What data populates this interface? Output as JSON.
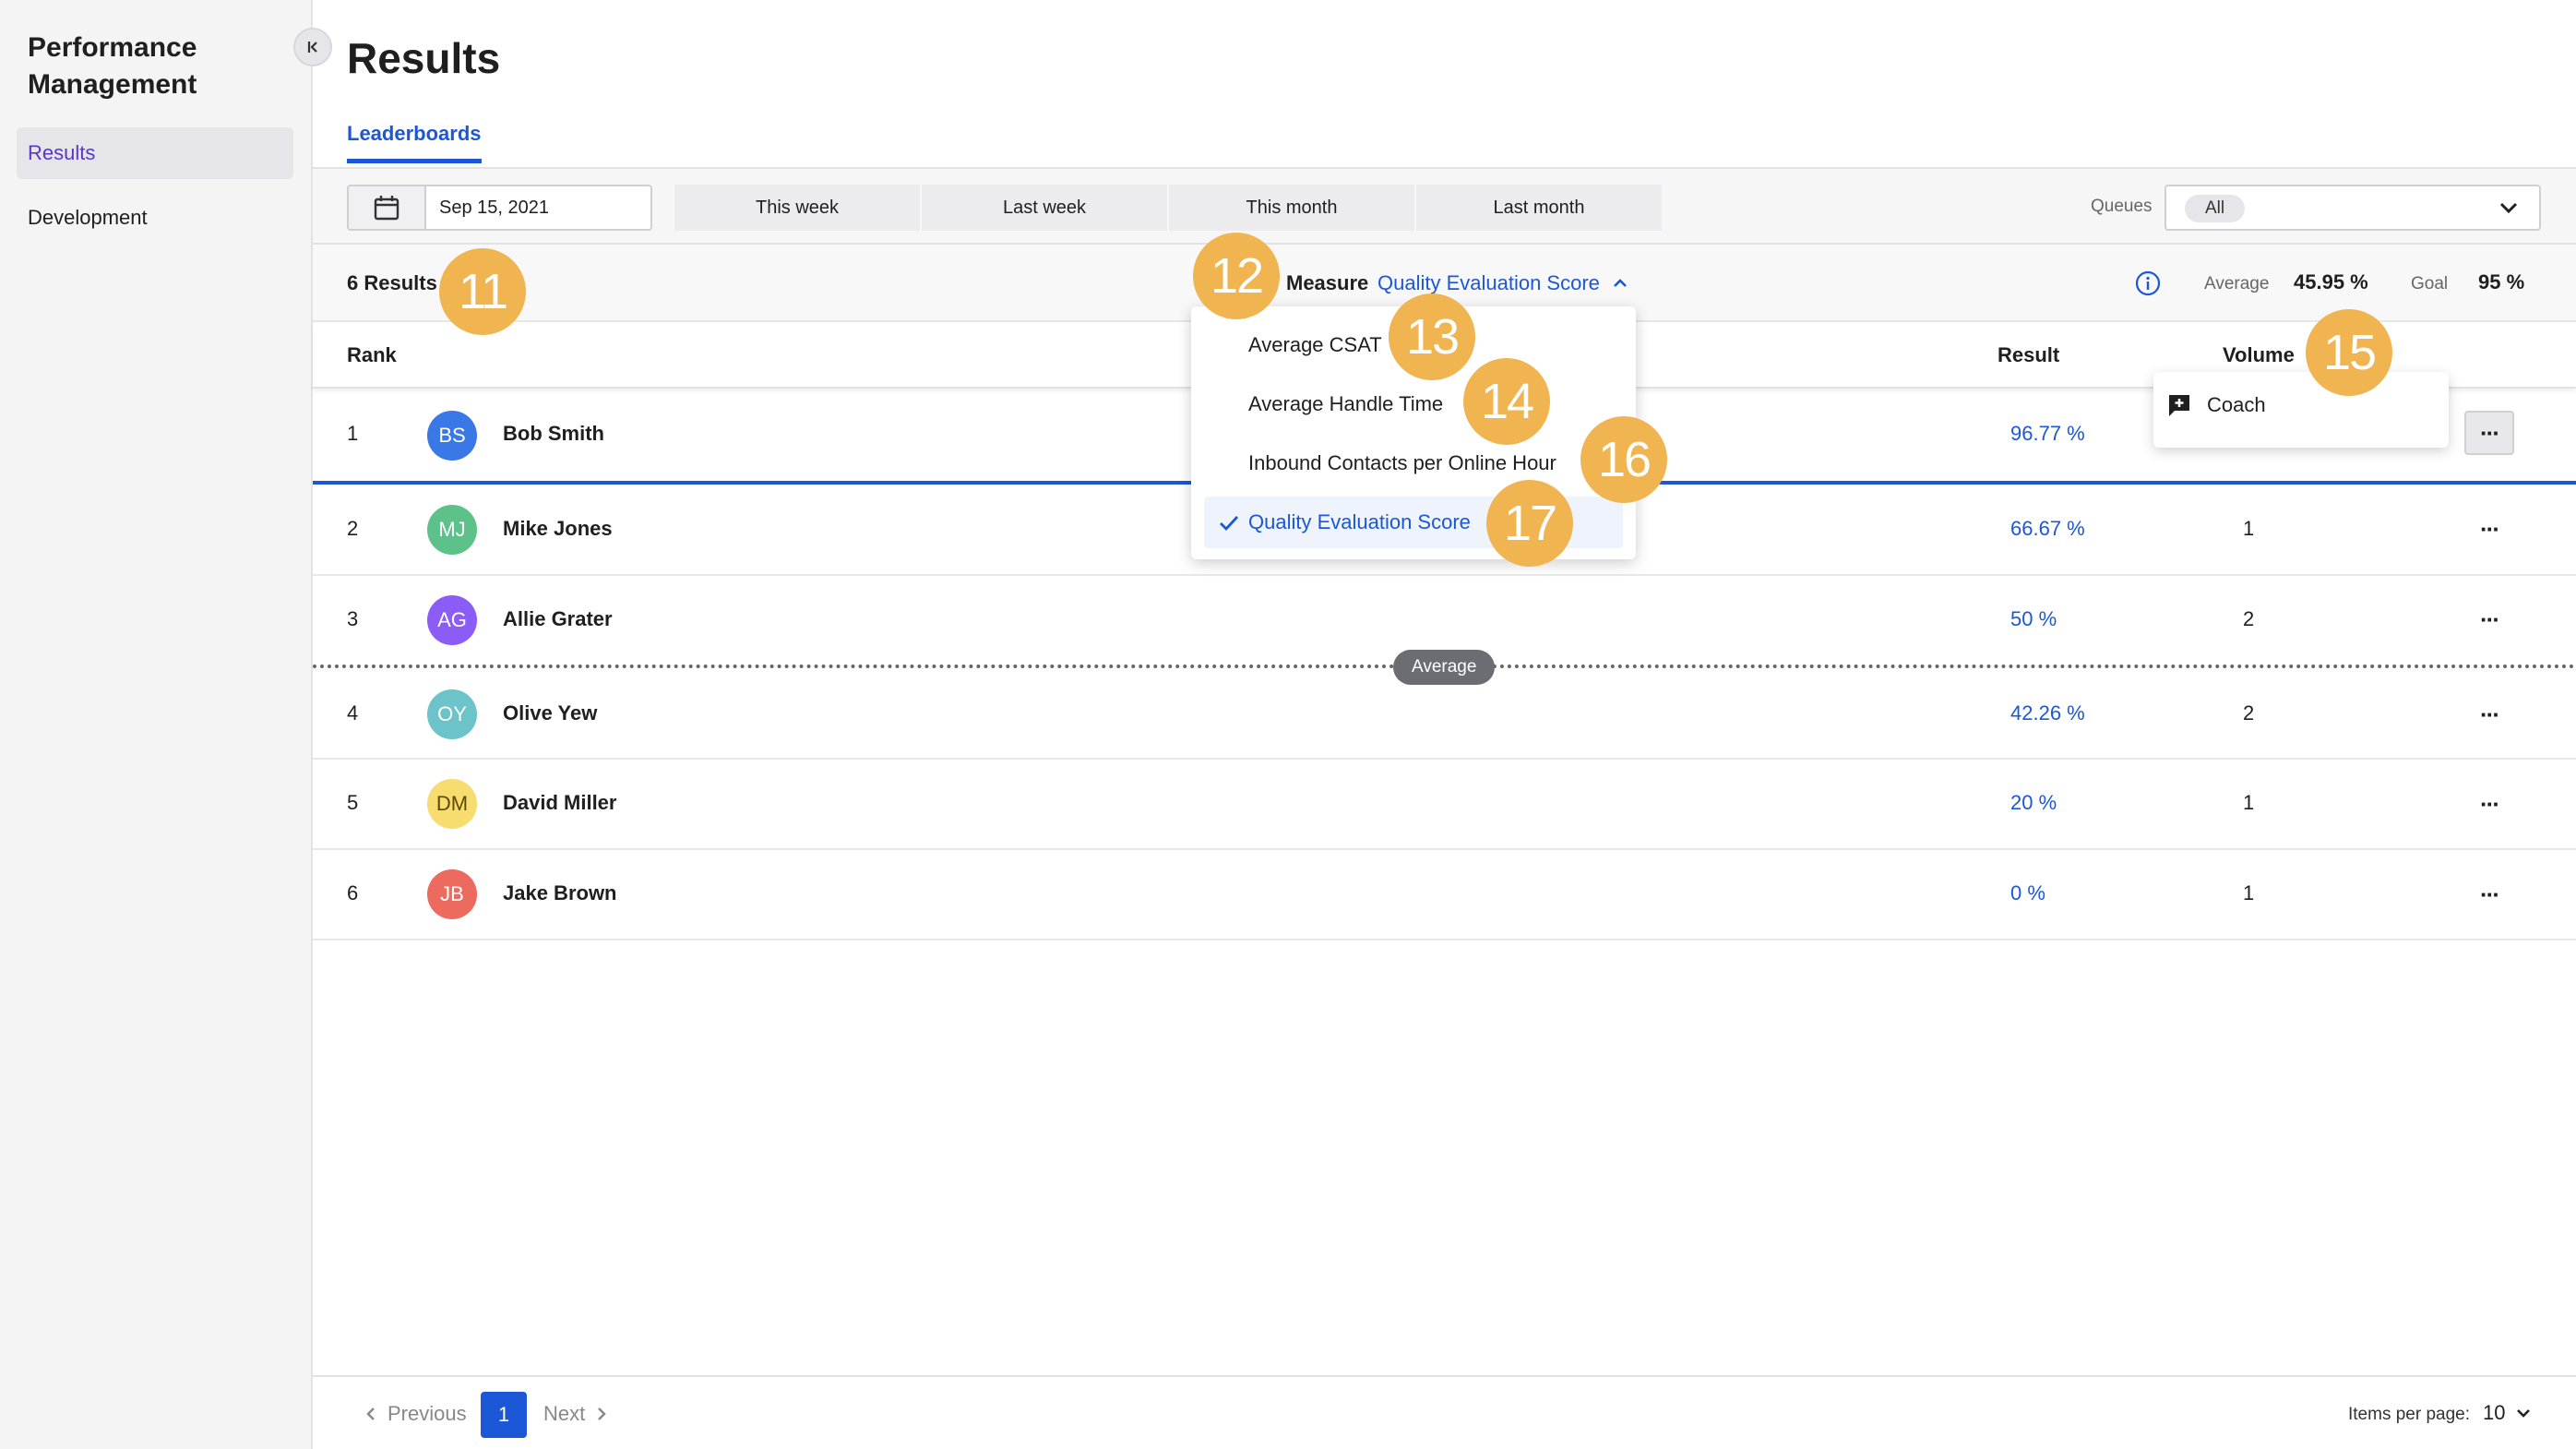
{
  "sidebar": {
    "app_title": "Performance Management",
    "items": [
      {
        "label": "Results",
        "active": true
      },
      {
        "label": "Development",
        "active": false
      }
    ]
  },
  "header": {
    "title": "Results",
    "tabs": [
      {
        "label": "Leaderboards",
        "active": true
      }
    ]
  },
  "toolbar": {
    "date": "Sep 15, 2021",
    "ranges": [
      "This week",
      "Last week",
      "This month",
      "Last month"
    ],
    "queues_label": "Queues",
    "queues_value": "All"
  },
  "summary": {
    "results_count": "6 Results",
    "measure_label": "Measure",
    "measure_value": "Quality Evaluation Score",
    "average_label": "Average",
    "average_value": "45.95 %",
    "goal_label": "Goal",
    "goal_value": "95 %"
  },
  "table": {
    "headers": {
      "rank": "Rank",
      "result": "Result",
      "volume": "Volume"
    },
    "rows": [
      {
        "rank": "1",
        "initials": "BS",
        "name": "Bob Smith",
        "result": "96.77 %",
        "volume": "",
        "avatar_color": "#3b78e7",
        "avatar_text": "#ffffff"
      },
      {
        "rank": "2",
        "initials": "MJ",
        "name": "Mike Jones",
        "result": "66.67 %",
        "volume": "1",
        "avatar_color": "#5cc28a",
        "avatar_text": "#ffffff"
      },
      {
        "rank": "3",
        "initials": "AG",
        "name": "Allie Grater",
        "result": "50 %",
        "volume": "2",
        "avatar_color": "#8b5cf6",
        "avatar_text": "#ffffff"
      },
      {
        "rank": "4",
        "initials": "OY",
        "name": "Olive Yew",
        "result": "42.26 %",
        "volume": "2",
        "avatar_color": "#6cc3c9",
        "avatar_text": "#ffffff"
      },
      {
        "rank": "5",
        "initials": "DM",
        "name": "David Miller",
        "result": "20 %",
        "volume": "1",
        "avatar_color": "#f7dc6f",
        "avatar_text": "#5a4a00"
      },
      {
        "rank": "6",
        "initials": "JB",
        "name": "Jake Brown",
        "result": "0 %",
        "volume": "1",
        "avatar_color": "#ec6a5e",
        "avatar_text": "#ffffff"
      }
    ],
    "average_marker": "Average"
  },
  "measure_menu": {
    "items": [
      {
        "label": "Average CSAT",
        "selected": false
      },
      {
        "label": "Average Handle Time",
        "selected": false
      },
      {
        "label": "Inbound Contacts per Online Hour",
        "selected": false
      },
      {
        "label": "Quality Evaluation Score",
        "selected": true
      }
    ]
  },
  "row_menu": {
    "items": [
      {
        "label": "Coach",
        "icon": "add-comment-icon"
      }
    ]
  },
  "badges": [
    "11",
    "12",
    "13",
    "14",
    "15",
    "16",
    "17"
  ],
  "pagination": {
    "previous": "Previous",
    "current": "1",
    "next": "Next",
    "items_per_page_label": "Items per page:",
    "items_per_page_value": "10"
  },
  "colors": {
    "accent": "#1b57d6",
    "badge": "#f0b450",
    "selected_nav": "#5a36c9"
  }
}
